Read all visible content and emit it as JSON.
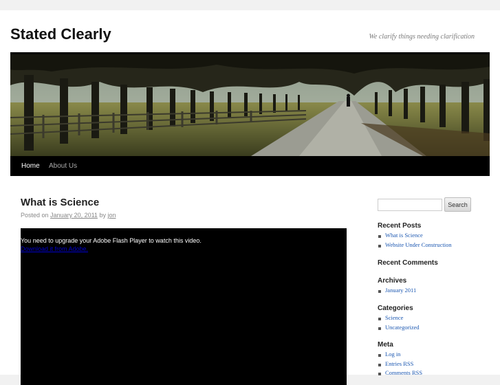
{
  "site": {
    "title": "Stated Clearly",
    "description": "We clarify things needing clarification"
  },
  "nav": {
    "items": [
      {
        "label": "Home",
        "current": true
      },
      {
        "label": "About Us",
        "current": false
      }
    ]
  },
  "post": {
    "title": "What is Science",
    "meta_prefix": "Posted on",
    "date": "January 20, 2011",
    "meta_by": "by",
    "author": "jon",
    "video_message": "You need to upgrade your Adobe Flash Player to watch this video.",
    "video_link": "Download it from Adobe."
  },
  "search": {
    "value": "",
    "button_label": "Search"
  },
  "sidebar": {
    "recent_posts": {
      "title": "Recent Posts",
      "items": [
        "What is Science",
        "Website Under Construction"
      ]
    },
    "recent_comments": {
      "title": "Recent Comments"
    },
    "archives": {
      "title": "Archives",
      "items": [
        "January 2011"
      ]
    },
    "categories": {
      "title": "Categories",
      "items": [
        "Science",
        "Uncategorized"
      ]
    },
    "meta": {
      "title": "Meta",
      "items": [
        "Log in",
        "Entries RSS",
        "Comments RSS"
      ]
    }
  },
  "colors": {
    "link": "#1b57b1",
    "nav_bg": "#000000",
    "page_bg": "#f1f1f1"
  }
}
